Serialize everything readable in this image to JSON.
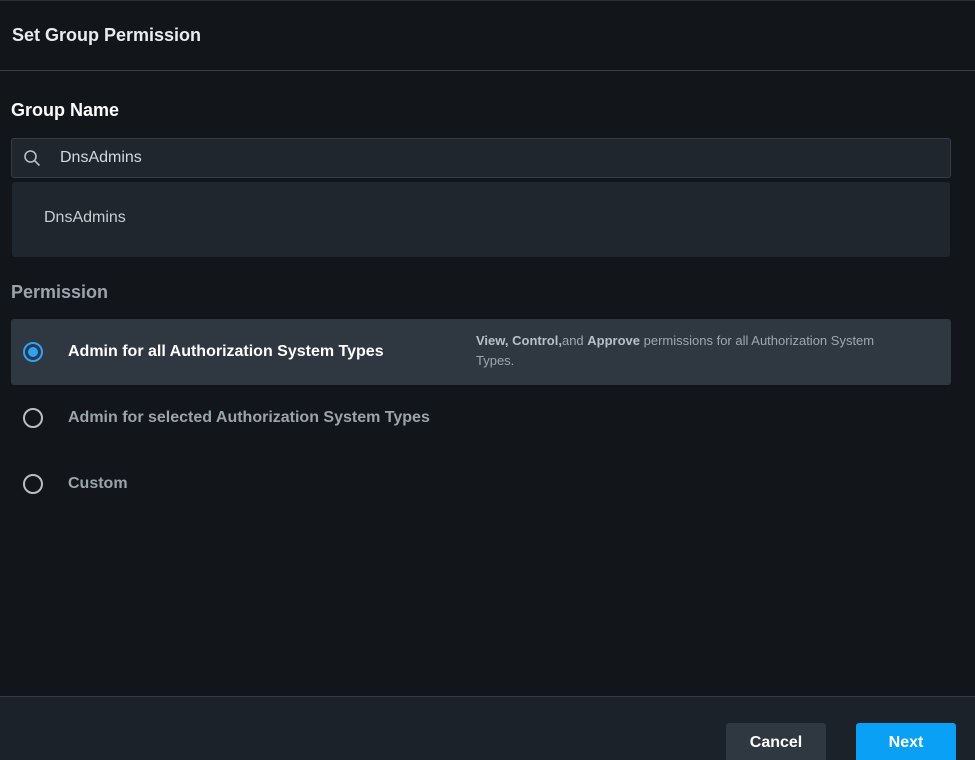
{
  "header": {
    "title": "Set Group Permission"
  },
  "group_name": {
    "label": "Group Name",
    "search": {
      "value": "DnsAdmins",
      "icon": "search-icon"
    },
    "suggestions": [
      "DnsAdmins"
    ]
  },
  "permission": {
    "label": "Permission",
    "options": [
      {
        "label": "Admin for all Authorization System Types",
        "selected": true,
        "desc_bold_1": "View, Control,",
        "desc_text_1": "and ",
        "desc_bold_2": "Approve",
        "desc_text_2": " permissions for all Authorization System Types."
      },
      {
        "label": "Admin for selected Authorization System Types",
        "selected": false
      },
      {
        "label": "Custom",
        "selected": false
      }
    ]
  },
  "footer": {
    "cancel_label": "Cancel",
    "next_label": "Next"
  },
  "colors": {
    "accent": "#0aa0f5",
    "radio_checked": "#2aa3ff",
    "background": "#12151a"
  }
}
